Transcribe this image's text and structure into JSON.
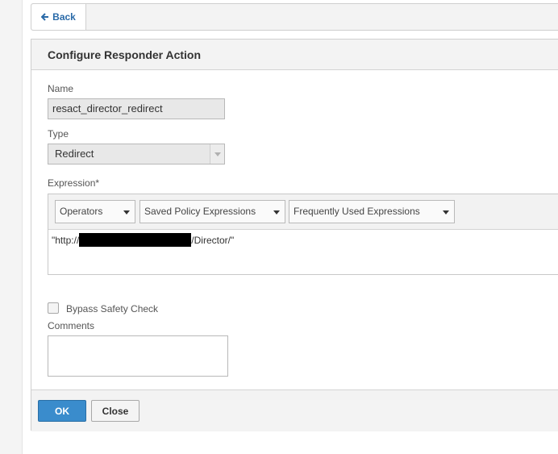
{
  "nav": {
    "back_label": "Back"
  },
  "dialog": {
    "title": "Configure Responder Action",
    "name_label": "Name",
    "name_value": "resact_director_redirect",
    "type_label": "Type",
    "type_value": "Redirect",
    "expression_label": "Expression*",
    "expression_toolbar": {
      "operators": "Operators",
      "saved_policy": "Saved Policy Expressions",
      "frequently_used": "Frequently Used Expressions"
    },
    "expression_prefix": "\"http://",
    "expression_suffix": "/Director/\"",
    "bypass_label": "Bypass Safety Check",
    "bypass_checked": false,
    "comments_label": "Comments",
    "comments_value": "",
    "ok_label": "OK",
    "close_label": "Close"
  },
  "colors": {
    "link": "#2a6aa8",
    "primary_button": "#3a8ccc"
  }
}
